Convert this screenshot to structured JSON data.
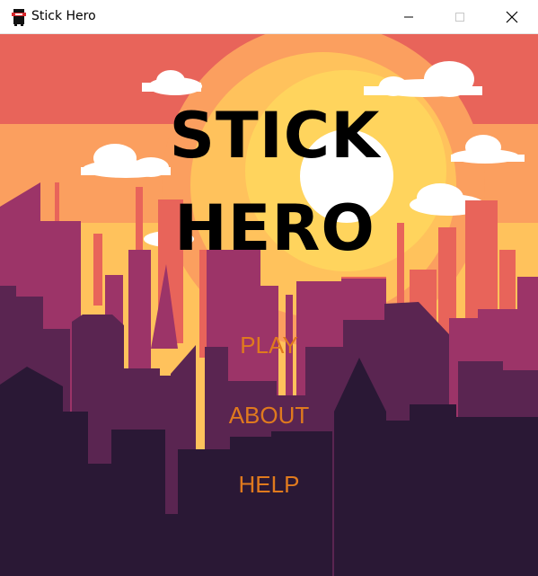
{
  "window": {
    "title": "Stick Hero",
    "app_icon": "ninja-icon",
    "controls": [
      "minimize-icon",
      "maximize-icon",
      "close-icon"
    ]
  },
  "game": {
    "title_line1": "STICK",
    "title_line2": "HERO"
  },
  "menu": {
    "play_label": "PLAY",
    "about_label": "ABOUT",
    "help_label": "HELP"
  },
  "colors": {
    "sky": "#e8645a",
    "sun_outer": "#ffc25c",
    "sun_inner": "#ffd45d",
    "far_buildings": "#e8645a",
    "mid_buildings": "#9c3468",
    "near_buildings": "#5a2551",
    "front_buildings": "#2a1835",
    "menu_text": "#e07a1e"
  }
}
